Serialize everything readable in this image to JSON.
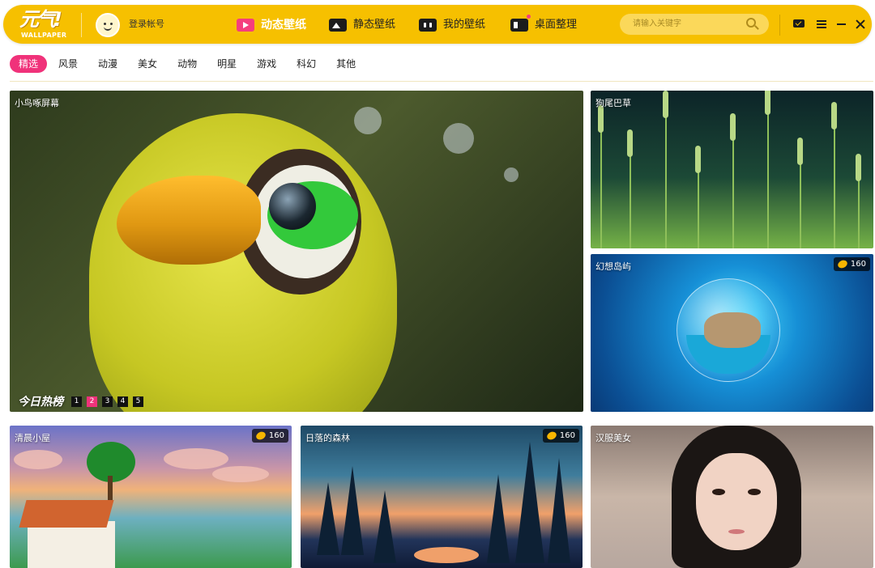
{
  "header": {
    "logo_text": "元气!",
    "logo_sub": "WALLPAPER",
    "login_label": "登录帐号",
    "nav": [
      {
        "label": "动态壁纸",
        "icon": "play-icon",
        "active": true
      },
      {
        "label": "静态壁纸",
        "icon": "image-icon",
        "active": false
      },
      {
        "label": "我的壁纸",
        "icon": "my-wallpaper-icon",
        "active": false
      },
      {
        "label": "桌面整理",
        "icon": "desktop-organize-icon",
        "active": false
      }
    ],
    "search_placeholder": "请输入关键字"
  },
  "categories": [
    "精选",
    "风景",
    "动漫",
    "美女",
    "动物",
    "明星",
    "游戏",
    "科幻",
    "其他"
  ],
  "active_category": "精选",
  "tiles": [
    {
      "title": "小鸟啄屏幕",
      "price": null
    },
    {
      "title": "狗尾巴草",
      "price": null
    },
    {
      "title": "幻想岛屿",
      "price": "160"
    },
    {
      "title": "清晨小屋",
      "price": "160"
    },
    {
      "title": "日落的森林",
      "price": "160"
    },
    {
      "title": "汉服美女",
      "price": null
    }
  ],
  "hot": {
    "label": "今日热榜",
    "pages": [
      "1",
      "2",
      "3",
      "4",
      "5"
    ],
    "current_page": "2"
  },
  "colors": {
    "header_bg": "#f6c000",
    "accent_pink": "#f0327a",
    "coin": "#f7b500"
  }
}
